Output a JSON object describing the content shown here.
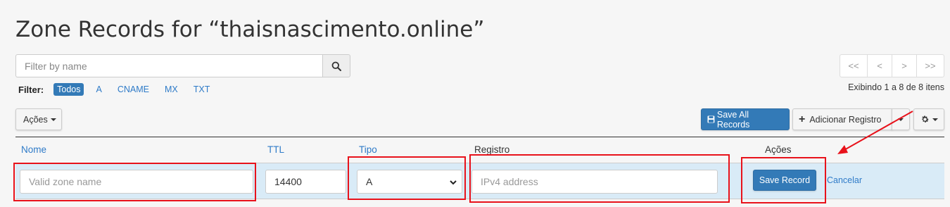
{
  "page": {
    "title": "Zone Records for “thaisnascimento.online”"
  },
  "search": {
    "placeholder": "Filter by name",
    "value": ""
  },
  "filter": {
    "label": "Filter:",
    "options": [
      "Todos",
      "A",
      "CNAME",
      "MX",
      "TXT"
    ],
    "active": "Todos"
  },
  "pagination": {
    "buttons": [
      "<<",
      "<",
      ">",
      ">>"
    ],
    "showing": "Exibindo 1 a 8 de 8 itens"
  },
  "toolbar": {
    "actions_label": "Ações",
    "save_all_label": "Save All Records",
    "add_record_label": "Adicionar Registro"
  },
  "table": {
    "headers": {
      "name": "Nome",
      "ttl": "TTL",
      "type": "Tipo",
      "record": "Registro",
      "actions": "Ações"
    },
    "edit_row": {
      "name_placeholder": "Valid zone name",
      "ttl_value": "14400",
      "type_value": "A",
      "record_placeholder": "IPv4 address",
      "save_label": "Save Record",
      "cancel_label": "Cancelar"
    }
  },
  "colors": {
    "primary": "#337ab7",
    "link": "#2f7bc8",
    "highlight": "#e8121b",
    "row_bg": "#d9ebf7"
  }
}
